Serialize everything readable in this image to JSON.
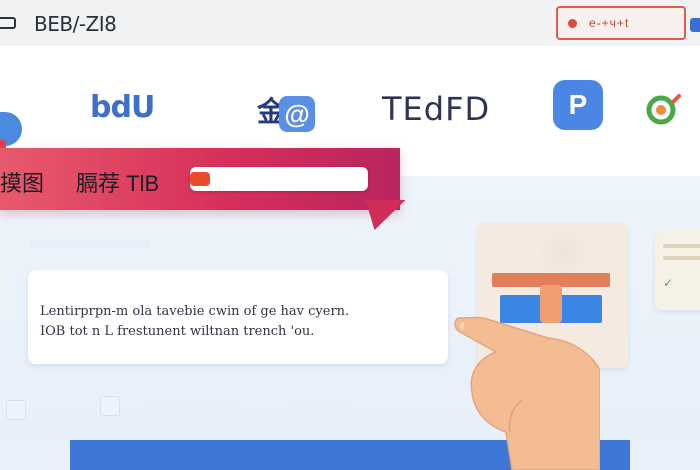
{
  "topbar": {
    "title_main": "BEB/-ZI8",
    "title_sub": "",
    "action_text": "e-+ч+t",
    "accent": "#e25a48"
  },
  "logos": {
    "logo1": "bdU",
    "logo2": "金",
    "logo2_badge": "@",
    "logo3": "ТEdFD",
    "logo4": "P",
    "logo5_icon": "green-orange-circle-icon"
  },
  "banner": {
    "text_a": "摸图",
    "text_b": "膈荐 TlB",
    "input_value": "",
    "color": "#d7305a"
  },
  "message": {
    "line1": "Lentirprpn-m ola tavebie cwin of ge hav cyern.",
    "line2": "IOB tot n L frestunent wiltnan trench 'ou."
  },
  "colors": {
    "brand_blue": "#3f70c9",
    "banner_pink": "#d7305a",
    "bottom_blue": "#3f77d6"
  }
}
